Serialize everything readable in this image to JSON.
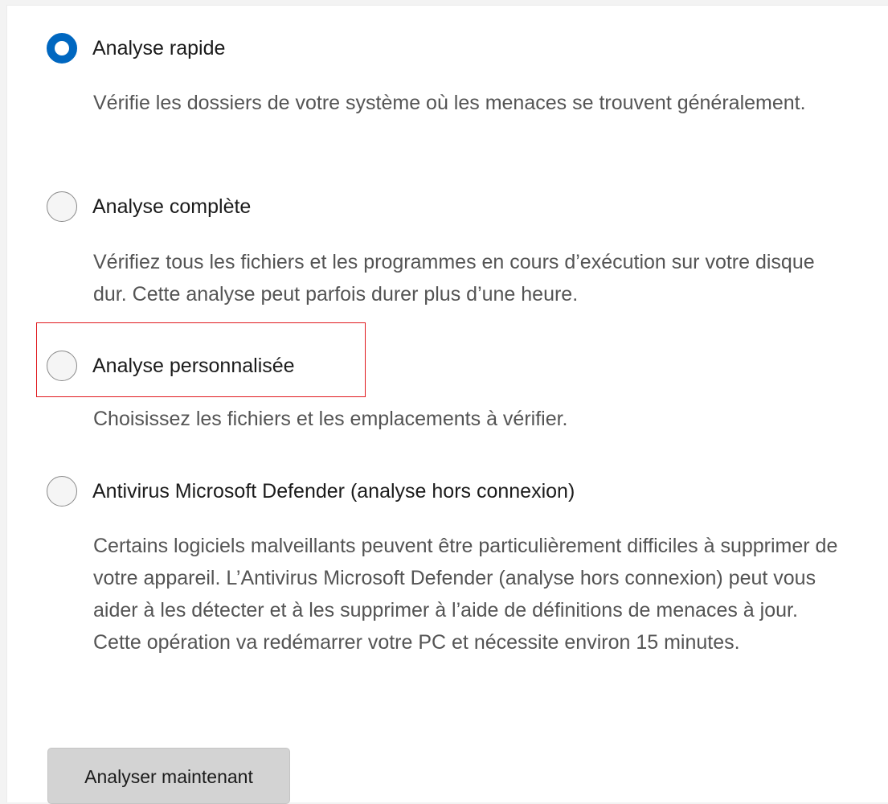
{
  "scan_options": [
    {
      "label": "Analyse rapide",
      "description": "Vérifie les dossiers de votre système où les menaces se trouvent généralement.",
      "selected": true
    },
    {
      "label": "Analyse complète",
      "description": "Vérifiez tous les fichiers et les programmes en cours d’exécution sur votre disque dur. Cette analyse peut parfois durer plus d’une heure.",
      "selected": false
    },
    {
      "label": "Analyse personnalisée",
      "description": "Choisissez les fichiers et les emplacements à vérifier.",
      "selected": false
    },
    {
      "label": "Antivirus Microsoft Defender (analyse hors connexion)",
      "description": "Certains logiciels malveillants peuvent être particulièrement difficiles à supprimer de votre appareil. L’Antivirus Microsoft Defender (analyse hors connexion) peut vous aider à les détecter et à les supprimer à l’aide de définitions de menaces à jour. Cette opération va redémarrer votre PC et nécessite environ 15 minutes.",
      "selected": false
    }
  ],
  "scan_button": {
    "label": "Analyser maintenant"
  },
  "colors": {
    "accent": "#0067c0",
    "highlight_border": "#e0191e",
    "description_text": "#545454"
  }
}
